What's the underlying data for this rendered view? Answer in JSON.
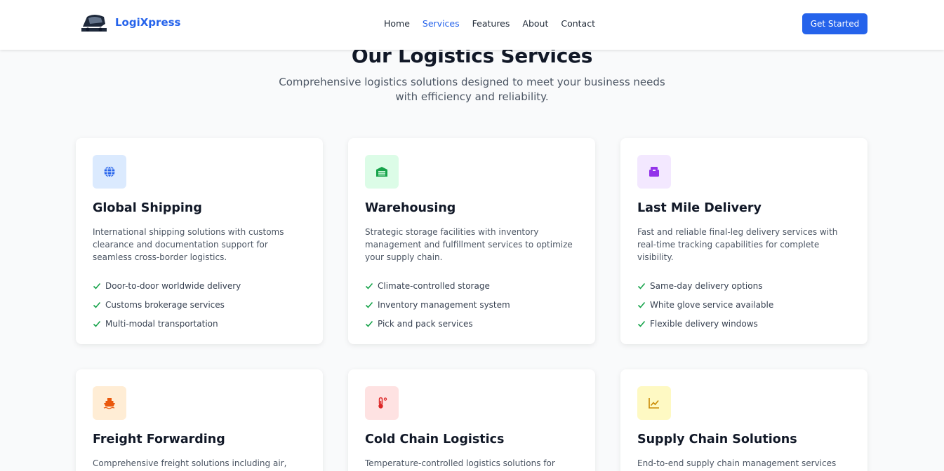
{
  "brand": {
    "name": "LogiXpress",
    "logo_wordmark": "LOGIXPRESS"
  },
  "nav": {
    "links": [
      "Home",
      "Services",
      "Features",
      "About",
      "Contact"
    ],
    "active_index": 1,
    "cta_label": "Get Started"
  },
  "hero": {
    "title": "Our Logistics Services",
    "subtitle": "Comprehensive logistics solutions designed to meet your business needs with efficiency and reliability."
  },
  "colors": {
    "accent": "#2563eb",
    "check": "#16a34a"
  },
  "cards": [
    {
      "icon": "globe-icon",
      "icon_bg": "#dbeafe",
      "icon_color": "#2563eb",
      "title": "Global Shipping",
      "description": "International shipping solutions with customs clearance and documentation support for seamless cross-border logistics.",
      "features": [
        "Door-to-door worldwide delivery",
        "Customs brokerage services",
        "Multi-modal transportation"
      ]
    },
    {
      "icon": "warehouse-icon",
      "icon_bg": "#dcfce7",
      "icon_color": "#16a34a",
      "title": "Warehousing",
      "description": "Strategic storage facilities with inventory management and fulfillment services to optimize your supply chain.",
      "features": [
        "Climate-controlled storage",
        "Inventory management system",
        "Pick and pack services"
      ]
    },
    {
      "icon": "box-icon",
      "icon_bg": "#f3e8ff",
      "icon_color": "#9333ea",
      "title": "Last Mile Delivery",
      "description": "Fast and reliable final-leg delivery services with real-time tracking capabilities for complete visibility.",
      "features": [
        "Same-day delivery options",
        "White glove service available",
        "Flexible delivery windows"
      ]
    },
    {
      "icon": "ship-icon",
      "icon_bg": "#ffedd5",
      "icon_color": "#ea580c",
      "title": "Freight Forwarding",
      "description": "Comprehensive freight solutions including air,",
      "features": []
    },
    {
      "icon": "thermometer-icon",
      "icon_bg": "#fee2e2",
      "icon_color": "#dc2626",
      "title": "Cold Chain Logistics",
      "description": "Temperature-controlled logistics solutions for",
      "features": []
    },
    {
      "icon": "chart-line-icon",
      "icon_bg": "#fef9c3",
      "icon_color": "#ca8a04",
      "title": "Supply Chain Solutions",
      "description": "End-to-end supply chain management services",
      "features": []
    }
  ]
}
